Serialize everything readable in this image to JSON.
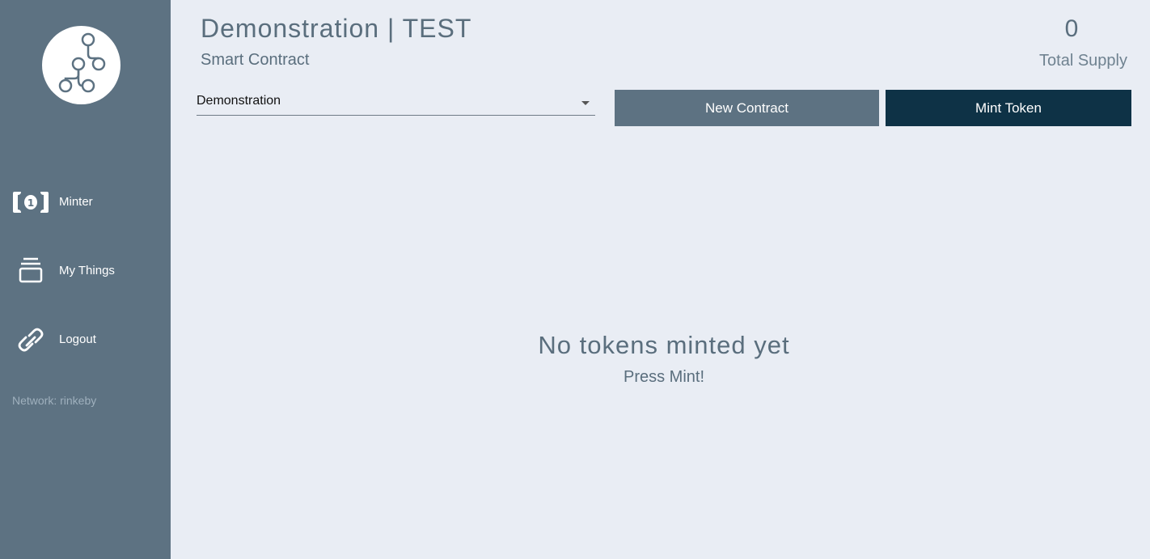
{
  "sidebar": {
    "logo_icon": "contract-graph-icon",
    "items": [
      {
        "label": "Minter",
        "icon": "banknote-icon"
      },
      {
        "label": "My Things",
        "icon": "stack-icon"
      },
      {
        "label": "Logout",
        "icon": "link-icon"
      }
    ],
    "network_text": "Network: rinkeby"
  },
  "header": {
    "title": "Demonstration | TEST",
    "subtitle": "Smart Contract",
    "total_supply_value": "0",
    "total_supply_label": "Total Supply"
  },
  "toolbar": {
    "contract_select_value": "Demonstration",
    "new_contract_label": "New Contract",
    "mint_token_label": "Mint Token"
  },
  "empty_state": {
    "title": "No tokens minted yet",
    "subtitle": "Press Mint!"
  },
  "colors": {
    "sidebar_bg": "#5d7282",
    "page_bg": "#e9edf4",
    "primary_button": "#0e3246",
    "secondary_button": "#5d7282",
    "text": "#5a6e7d"
  }
}
